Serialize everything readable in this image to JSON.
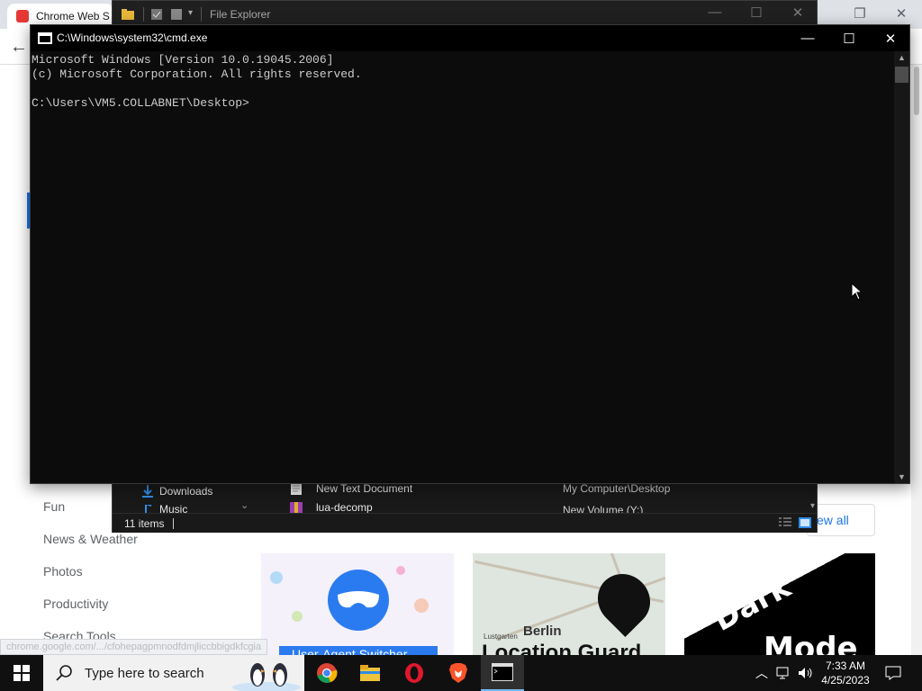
{
  "chrome": {
    "tab_title": "Chrome Web S",
    "status_url": "chrome.google.com/.../cfohepagpmnodfdmjliccbbigdkfcgia",
    "categories": [
      "Fun",
      "News & Weather",
      "Photos",
      "Productivity",
      "Search Tools"
    ],
    "view_all_label": "ew all",
    "tiles": {
      "tile1_caption": "User-Agent Switcher",
      "tile2_map_label": "Berlin",
      "tile2_small_label": "Lustgarten",
      "tile2_caption": "Location Guard",
      "tile3_word1": "Dark",
      "tile3_word2": "Mode"
    }
  },
  "explorer": {
    "title": "File Explorer",
    "nav_items": [
      "Downloads",
      "Music"
    ],
    "files": [
      {
        "name": "New Text Document",
        "location": "My Computer\\Desktop"
      },
      {
        "name": "lua-decomp",
        "location": "New Volume (Y:)"
      }
    ],
    "status": "11 items"
  },
  "cmd": {
    "title": "C:\\Windows\\system32\\cmd.exe",
    "lines": [
      "Microsoft Windows [Version 10.0.19045.2006]",
      "(c) Microsoft Corporation. All rights reserved.",
      "",
      "C:\\Users\\VM5.COLLABNET\\Desktop>"
    ]
  },
  "taskbar": {
    "search_placeholder": "Type here to search",
    "time": "7:33 AM",
    "date": "4/25/2023",
    "apps": [
      "chrome-icon",
      "file-explorer-icon",
      "opera-icon",
      "brave-icon",
      "cmd-icon"
    ]
  },
  "colors": {
    "cmd_background": "#0c0c0c",
    "cmd_text": "#cccccc",
    "taskbar": "#101010",
    "accent": "#1a73e8"
  }
}
